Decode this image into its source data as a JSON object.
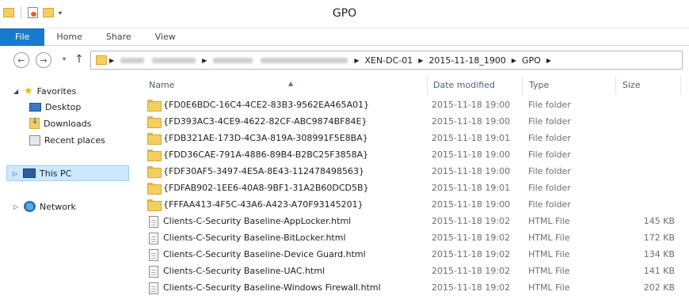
{
  "window": {
    "title": "GPO"
  },
  "ribbon": {
    "tabs": [
      "File",
      "Home",
      "Share",
      "View"
    ]
  },
  "address": {
    "crumbs": [
      "XEN-DC-01",
      "2015-11-18_1900",
      "GPO"
    ]
  },
  "navpane": {
    "favorites": "Favorites",
    "desktop": "Desktop",
    "downloads": "Downloads",
    "recent": "Recent places",
    "thispc": "This PC",
    "network": "Network"
  },
  "columns": {
    "name": "Name",
    "date": "Date modified",
    "type": "Type",
    "size": "Size"
  },
  "files": [
    {
      "name": "{FD0E6BDC-16C4-4CE2-83B3-9562EA465A01}",
      "date": "2015-11-18 19:00",
      "type": "File folder",
      "size": "",
      "icon": "folder-icon"
    },
    {
      "name": "{FD393AC3-4CE9-4622-82CF-ABC9874BF84E}",
      "date": "2015-11-18 19:00",
      "type": "File folder",
      "size": "",
      "icon": "folder-icon"
    },
    {
      "name": "{FDB321AE-173D-4C3A-819A-308991F5E8BA}",
      "date": "2015-11-18 19:01",
      "type": "File folder",
      "size": "",
      "icon": "folder-icon"
    },
    {
      "name": "{FDD36CAE-791A-4886-89B4-B2BC25F3858A}",
      "date": "2015-11-18 19:00",
      "type": "File folder",
      "size": "",
      "icon": "folder-icon"
    },
    {
      "name": "{FDF30AF5-3497-4E5A-8E43-112478498563}",
      "date": "2015-11-18 19:00",
      "type": "File folder",
      "size": "",
      "icon": "folder-icon"
    },
    {
      "name": "{FDFAB902-1EE6-40A8-9BF1-31A2B60DCD5B}",
      "date": "2015-11-18 19:01",
      "type": "File folder",
      "size": "",
      "icon": "folder-icon"
    },
    {
      "name": "{FFFAA413-4F5C-43A6-A423-A70F93145201}",
      "date": "2015-11-18 19:00",
      "type": "File folder",
      "size": "",
      "icon": "folder-icon"
    },
    {
      "name": "Clients-C-Security Baseline-AppLocker.html",
      "date": "2015-11-18 19:02",
      "type": "HTML File",
      "size": "145 KB",
      "icon": "html-file-icon"
    },
    {
      "name": "Clients-C-Security Baseline-BitLocker.html",
      "date": "2015-11-18 19:02",
      "type": "HTML File",
      "size": "172 KB",
      "icon": "html-file-icon"
    },
    {
      "name": "Clients-C-Security Baseline-Device Guard.html",
      "date": "2015-11-18 19:02",
      "type": "HTML File",
      "size": "134 KB",
      "icon": "html-file-icon"
    },
    {
      "name": "Clients-C-Security Baseline-UAC.html",
      "date": "2015-11-18 19:02",
      "type": "HTML File",
      "size": "141 KB",
      "icon": "html-file-icon"
    },
    {
      "name": "Clients-C-Security Baseline-Windows Firewall.html",
      "date": "2015-11-18 19:02",
      "type": "HTML File",
      "size": "202 KB",
      "icon": "html-file-icon"
    }
  ]
}
